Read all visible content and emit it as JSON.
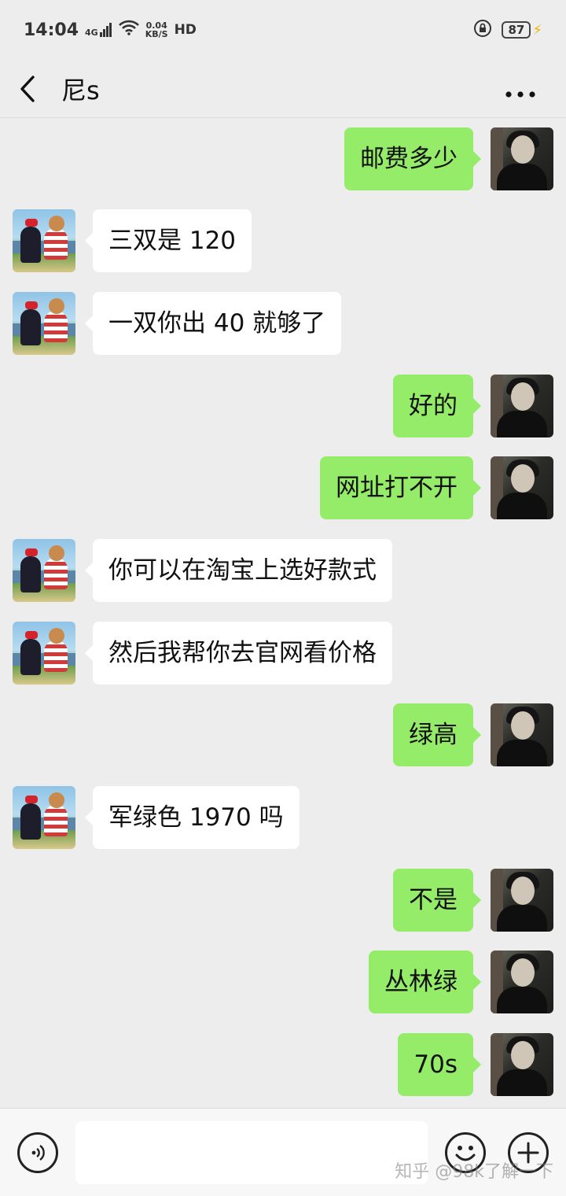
{
  "status_bar": {
    "time": "14:04",
    "network": "4G",
    "speed_value": "0.04",
    "speed_unit": "KB/S",
    "hd": "HD",
    "battery": "87"
  },
  "header": {
    "title": "尼s"
  },
  "messages": [
    {
      "side": "right",
      "text": "邮费多少"
    },
    {
      "side": "left",
      "text": "三双是 120"
    },
    {
      "side": "left",
      "text": "一双你出 40 就够了"
    },
    {
      "side": "right",
      "text": "好的"
    },
    {
      "side": "right",
      "text": "网址打不开"
    },
    {
      "side": "left",
      "text": "你可以在淘宝上选好款式"
    },
    {
      "side": "left",
      "text": "然后我帮你去官网看价格"
    },
    {
      "side": "right",
      "text": "绿高"
    },
    {
      "side": "left",
      "text": "军绿色 1970 吗"
    },
    {
      "side": "right",
      "text": "不是"
    },
    {
      "side": "right",
      "text": "丛林绿"
    },
    {
      "side": "right",
      "text": "70s"
    }
  ],
  "watermark": "知乎 @98k了解一下",
  "colors": {
    "sent_bubble": "#95ec69",
    "received_bubble": "#ffffff",
    "background": "#ededed"
  },
  "icons": {
    "back": "back-arrow-icon",
    "more": "more-dots-icon",
    "voice": "voice-icon",
    "emoji": "emoji-icon",
    "plus": "plus-icon"
  }
}
